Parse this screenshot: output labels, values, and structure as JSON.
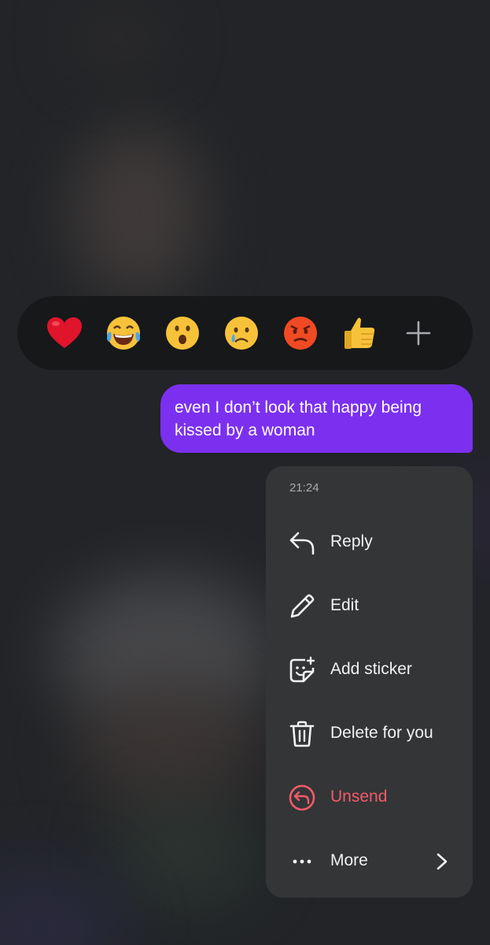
{
  "reactions": [
    {
      "name": "heart",
      "label": "❤️"
    },
    {
      "name": "tears-of-joy",
      "label": "😂"
    },
    {
      "name": "surprised",
      "label": "😮"
    },
    {
      "name": "crying",
      "label": "😢"
    },
    {
      "name": "angry",
      "label": "😡"
    },
    {
      "name": "thumbs-up",
      "label": "👍"
    }
  ],
  "message": {
    "text": "even I don’t look that happy being kissed by a woman"
  },
  "menu": {
    "timestamp": "21:24",
    "items": [
      {
        "label": "Reply",
        "icon": "reply-icon"
      },
      {
        "label": "Edit",
        "icon": "pencil-icon"
      },
      {
        "label": "Add sticker",
        "icon": "sticker-icon"
      },
      {
        "label": "Delete for you",
        "icon": "trash-icon"
      },
      {
        "label": "Unsend",
        "icon": "unsend-icon"
      },
      {
        "label": "More",
        "icon": "more-dots-icon"
      }
    ]
  },
  "colors": {
    "bubble": "#7b30f0",
    "menu_bg": "#333537",
    "danger": "#f35b69",
    "background": "#222427"
  }
}
